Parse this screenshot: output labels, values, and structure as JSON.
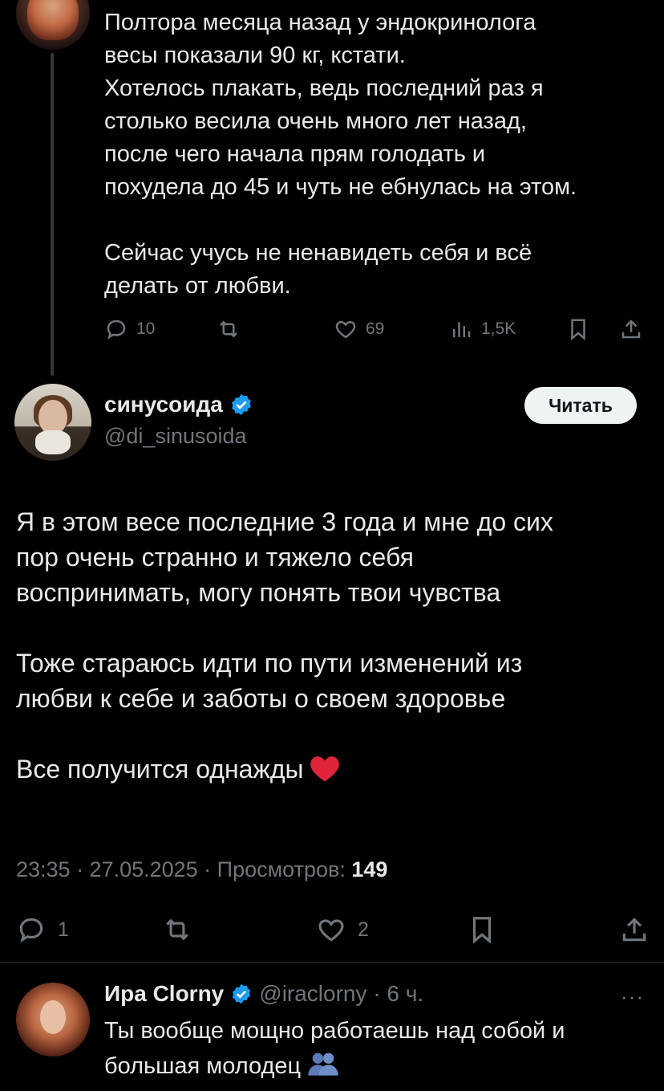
{
  "parent_tweet": {
    "text": "Полтора месяца назад у эндокринолога\nвесы показали 90 кг, кстати.\nХотелось плакать, ведь последний раз я\nстолько весила очень много лет назад,\nпосле чего начала прям голодать и\nпохудела до 45 и чуть не ебнулась на этом.\n\nСейчас учусь не ненавидеть себя и всё\nделать от любви.",
    "replies": "10",
    "likes": "69",
    "views": "1,5K"
  },
  "main_tweet": {
    "author_name": "синусоида",
    "author_handle": "@di_sinusoida",
    "follow_label": "Читать",
    "text": "Я в этом весе последние 3 года и мне до сих\nпор очень странно и тяжело себя\nвоспринимать, могу понять твои чувства\n\nТоже стараюсь идти по пути изменений из\nлюбви к себе и заботы о своем здоровье\n\nВсе получится однажды",
    "time": "23:35 · 27.05.2025 · Просмотров: ",
    "views": "149",
    "replies": "1",
    "likes": "2"
  },
  "reply_tweet": {
    "author_name": "Ира Clorny",
    "author_handle": "@iraclorny · 6 ч.",
    "more": "···",
    "text": "Ты вообще мощно работаешь над собой и\nбольшая молодец"
  },
  "colors": {
    "background": "#000000",
    "text": "#e7e9ea",
    "muted": "#71767b",
    "verified": "#1d9bf0",
    "divider": "#2f3336"
  }
}
